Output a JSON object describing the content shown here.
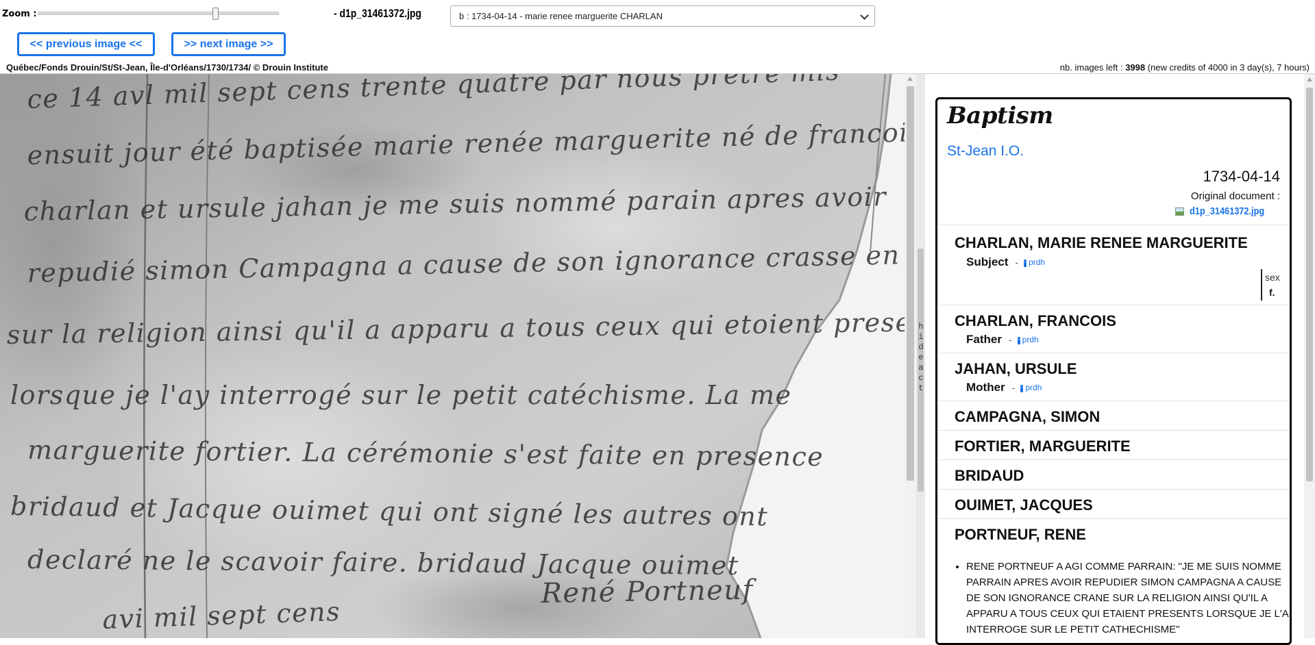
{
  "toolbar": {
    "zoom_label": "Zoom :",
    "zoom_level": 0.74,
    "file_name": "- d1p_31461372.jpg",
    "record_select_value": "b : 1734-04-14 - marie renee marguerite CHARLAN",
    "prev_label": "<< previous image <<",
    "next_label": ">> next image >>",
    "breadcrumb": "Québec/Fonds Drouin/St/St-Jean, Île-d'Orléans/1730/1734/ © Drouin Institute",
    "credits_prefix": "nb. images left : ",
    "credits_count": "3998",
    "credits_suffix": " (new credits of 4000 in 3 day(s), 7 hours)"
  },
  "viewer": {
    "handwriting_lines": [
      "ce 14 avl mil sept cens trente quatre par nous pretre mis",
      "ensuit jour été baptisée marie renée marguerite né de francois",
      "charlan et ursule jahan je me suis nommé parain apres avoir",
      "repudié simon Campagna a cause de son ignorance crasse en matiere",
      "sur la religion ainsi qu'il a apparu a tous ceux qui etoient presents",
      "lorsque je l'ay interrogé sur le petit catéchisme. La me",
      "marguerite fortier. La cérémonie s'est faite en presence",
      "bridaud et Jacque ouimet qui ont signé les autres ont",
      "declaré ne le scavoir faire.   bridaud   Jacque ouimet",
      "René Portneuf",
      "avi mil sept cens"
    ]
  },
  "side": {
    "hide_act": "hide act"
  },
  "act": {
    "type": "Baptism",
    "parish": "St-Jean I.O.",
    "date": "1734-04-14",
    "original_label": "Original document :",
    "original_file": "d1p_31461372.jpg",
    "sex_label": "sex",
    "sex_value": "f.",
    "persons": [
      {
        "name": "CHARLAN, MARIE RENEE MARGUERITE",
        "role": "Subject",
        "sep": "-",
        "link": "prdh"
      },
      {
        "name": "CHARLAN, FRANCOIS",
        "role": "Father",
        "sep": "-",
        "link": "prdh"
      },
      {
        "name": "JAHAN, URSULE",
        "role": "Mother",
        "sep": "-",
        "link": "prdh"
      },
      {
        "name": "CAMPAGNA, SIMON"
      },
      {
        "name": "FORTIER, MARGUERITE"
      },
      {
        "name": "BRIDAUD"
      },
      {
        "name": "OUIMET, JACQUES"
      },
      {
        "name": "PORTNEUF, RENE"
      }
    ],
    "notes": [
      "RENE PORTNEUF A AGI COMME PARRAIN: \"JE ME SUIS NOMME PARRAIN APRES AVOIR REPUDIER SIMON CAMPAGNA A CAUSE DE SON IGNORANCE CRANE SUR LA RELIGION AINSI QU'IL A APPARU A TOUS CEUX QUI ETAIENT PRESENTS LORSQUE JE L'AI INTERROGE SUR LE PETIT CATHECHISME\""
    ]
  }
}
